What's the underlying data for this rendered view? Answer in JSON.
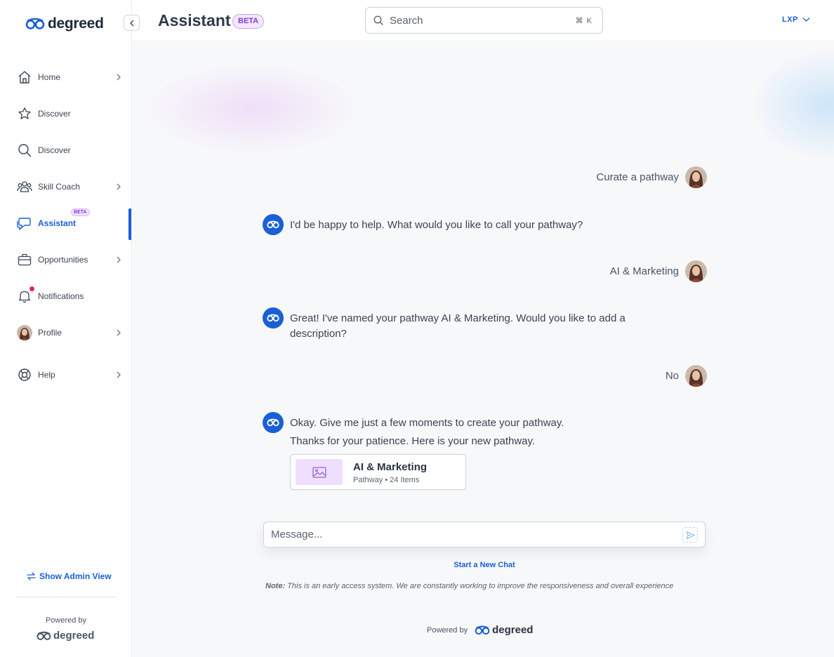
{
  "brand": {
    "name": "degreed",
    "primary_color": "#1a5fd6",
    "beta_color": "#8a37d6"
  },
  "sidebar": {
    "collapse_icon": "chevron-left-icon",
    "items": [
      {
        "label": "Home",
        "icon": "home-icon",
        "has_chevron": true,
        "active": false
      },
      {
        "label": "Discover",
        "icon": "star-icon",
        "has_chevron": false,
        "active": false
      },
      {
        "label": "Discover",
        "icon": "search-icon",
        "has_chevron": false,
        "active": false
      },
      {
        "label": "Skill Coach",
        "icon": "people-icon",
        "has_chevron": true,
        "active": false
      },
      {
        "label": "Assistant",
        "icon": "chat-icon",
        "has_chevron": false,
        "active": true,
        "badge": "BETA"
      },
      {
        "label": "Opportunities",
        "icon": "briefcase-icon",
        "has_chevron": true,
        "active": false
      },
      {
        "label": "Notifications",
        "icon": "bell-icon",
        "has_chevron": false,
        "active": false,
        "has_dot": true
      },
      {
        "label": "Profile",
        "icon": "avatar-icon",
        "has_chevron": true,
        "active": false
      },
      {
        "label": "Help",
        "icon": "lifebuoy-icon",
        "has_chevron": true,
        "active": false
      }
    ],
    "admin_link": "Show Admin View",
    "powered_by": "Powered by",
    "powered_logo": "degreed"
  },
  "header": {
    "title": "Assistant",
    "badge": "BETA",
    "search": {
      "placeholder": "Search",
      "shortcut": "⌘ K"
    },
    "product_switcher": "LXP"
  },
  "chat": {
    "messages": [
      {
        "role": "user",
        "text": "Curate a pathway"
      },
      {
        "role": "assistant",
        "text": "I'd be happy to help. What would you like to call your pathway?"
      },
      {
        "role": "user",
        "text": "AI & Marketing"
      },
      {
        "role": "assistant",
        "text": "Great! I've named your pathway AI & Marketing. Would you like to add a description?"
      },
      {
        "role": "user",
        "text": "No"
      },
      {
        "role": "assistant",
        "text": "Okay. Give me just a few moments to create your pathway.",
        "text2": "Thanks for your patience. Here is your new pathway."
      }
    ],
    "pathway_card": {
      "title": "AI & Marketing",
      "meta": "Pathway • 24 Items",
      "icon": "image-icon"
    },
    "composer": {
      "placeholder": "Message..."
    },
    "new_chat": "Start a New Chat",
    "note_label": "Note:",
    "note_text": "This is an early access system. We are constantly working to improve the responsiveness and overall experience",
    "powered_by": "Powered by",
    "powered_logo": "degreed"
  }
}
